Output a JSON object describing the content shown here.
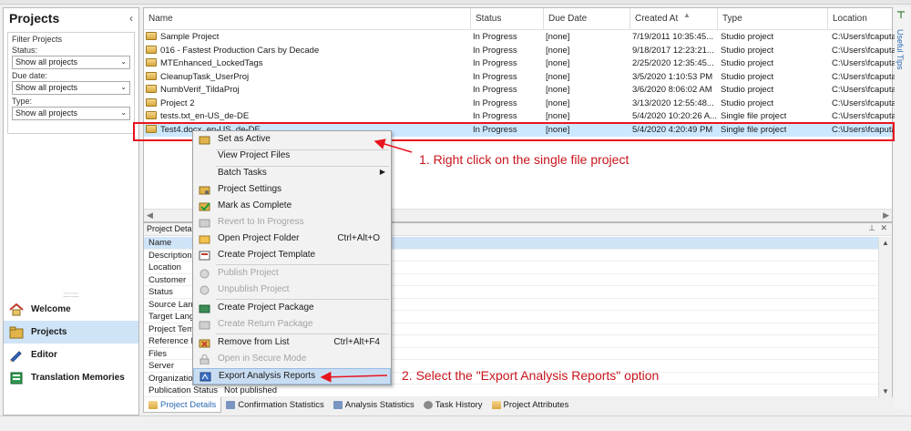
{
  "left_nav": {
    "title": "Projects",
    "collapse_glyph": "‹",
    "filter_title": "Filter Projects",
    "filters": [
      {
        "label": "Status:",
        "value": "Show all projects"
      },
      {
        "label": "Due date:",
        "value": "Show all projects"
      },
      {
        "label": "Type:",
        "value": "Show all projects"
      }
    ],
    "grip": "::::::::",
    "items": [
      {
        "label": "Welcome",
        "icon": "home-icon"
      },
      {
        "label": "Projects",
        "icon": "folder-icon"
      },
      {
        "label": "Editor",
        "icon": "pencil-icon"
      },
      {
        "label": "Translation Memories",
        "icon": "database-icon"
      }
    ]
  },
  "project_list": {
    "columns": [
      "Name",
      "Status",
      "Due Date",
      "Created At",
      "Type",
      "Location"
    ],
    "rows": [
      {
        "name": "Sample Project",
        "status": "In Progress",
        "due": "[none]",
        "created": "7/19/2011 10:35:45...",
        "type": "Studio project",
        "location": "C:\\Users\\fcaputa"
      },
      {
        "name": "016 - Fastest Production Cars by Decade",
        "status": "In Progress",
        "due": "[none]",
        "created": "9/18/2017 12:23:21...",
        "type": "Studio project",
        "location": "C:\\Users\\fcaputa"
      },
      {
        "name": "MTEnhanced_LockedTags",
        "status": "In Progress",
        "due": "[none]",
        "created": "2/25/2020 12:35:45...",
        "type": "Studio project",
        "location": "C:\\Users\\fcaputa"
      },
      {
        "name": "CleanupTask_UserProj",
        "status": "In Progress",
        "due": "[none]",
        "created": "3/5/2020 1:10:53 PM",
        "type": "Studio project",
        "location": "C:\\Users\\fcaputa"
      },
      {
        "name": "NumbVerif_TildaProj",
        "status": "In Progress",
        "due": "[none]",
        "created": "3/6/2020 8:06:02 AM",
        "type": "Studio project",
        "location": "C:\\Users\\fcaputa"
      },
      {
        "name": "Project 2",
        "status": "In Progress",
        "due": "[none]",
        "created": "3/13/2020 12:55:48...",
        "type": "Studio project",
        "location": "C:\\Users\\fcaputa"
      },
      {
        "name": "tests.txt_en-US_de-DE",
        "status": "In Progress",
        "due": "[none]",
        "created": "5/4/2020 10:20:26 A...",
        "type": "Single file project",
        "location": "C:\\Users\\fcaputa"
      },
      {
        "name": "Test4.docx_en-US_de-DE",
        "status": "In Progress",
        "due": "[none]",
        "created": "5/4/2020 4:20:49 PM",
        "type": "Single file project",
        "location": "C:\\Users\\fcaputa"
      }
    ]
  },
  "useful_tips": {
    "label": "Useful Tips"
  },
  "details": {
    "title": "Project Details",
    "pin": "⊥",
    "close": "✕",
    "header_row": "Name",
    "rows": [
      {
        "key": "Description",
        "value": ""
      },
      {
        "key": "Location",
        "value": ""
      },
      {
        "key": "Customer",
        "value": ""
      },
      {
        "key": "Status",
        "value": ""
      },
      {
        "key": "Source Lang",
        "value": ""
      },
      {
        "key": "Target Lang",
        "value": ""
      },
      {
        "key": "Project Tem",
        "value": ""
      },
      {
        "key": "Reference F",
        "value": ""
      },
      {
        "key": "Files",
        "value": ""
      },
      {
        "key": "Server",
        "value": ""
      },
      {
        "key": "Organization",
        "value": ""
      },
      {
        "key": "Publication Status",
        "value": "Not published"
      }
    ]
  },
  "tabs": [
    "Project Details",
    "Confirmation Statistics",
    "Analysis Statistics",
    "Task History",
    "Project Attributes"
  ],
  "context_menu": {
    "items": [
      {
        "label": "Set as Active",
        "enabled": true
      },
      {
        "label": "View Project Files",
        "enabled": true
      },
      {
        "label": "Batch Tasks",
        "enabled": true,
        "submenu": "▶"
      },
      {
        "label": "Project Settings",
        "enabled": true
      },
      {
        "label": "Mark as Complete",
        "enabled": true
      },
      {
        "label": "Revert to In Progress",
        "enabled": false
      },
      {
        "label": "Open Project Folder",
        "enabled": true,
        "shortcut": "Ctrl+Alt+O"
      },
      {
        "label": "Create Project Template",
        "enabled": true
      },
      {
        "label": "Publish Project",
        "enabled": false
      },
      {
        "label": "Unpublish Project",
        "enabled": false
      },
      {
        "label": "Create Project Package",
        "enabled": true
      },
      {
        "label": "Create Return Package",
        "enabled": false
      },
      {
        "label": "Remove from List",
        "enabled": true,
        "shortcut": "Ctrl+Alt+F4"
      },
      {
        "label": "Open in Secure Mode",
        "enabled": false
      },
      {
        "label": "Export Analysis Reports",
        "enabled": true
      }
    ]
  },
  "annotations": {
    "step1": "1. Right click on the single file project",
    "step2": "2. Select the \"Export Analysis Reports\" option"
  },
  "colors": {
    "annotation_red": "#e8141e",
    "selection_blue": "#cce8ff",
    "accent_blue": "#2b6bb3"
  }
}
